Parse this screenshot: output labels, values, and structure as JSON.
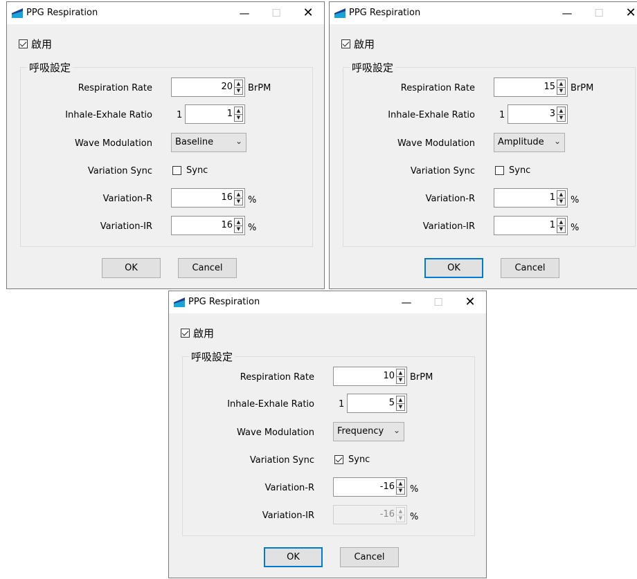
{
  "dialogs": [
    {
      "title": "PPG Respiration",
      "enable_label": "啟用",
      "enabled": true,
      "group_title": "呼吸設定",
      "labels": {
        "respiration_rate": "Respiration Rate",
        "inhale_exhale_ratio": "Inhale-Exhale Ratio",
        "wave_modulation": "Wave Modulation",
        "variation_sync": "Variation Sync",
        "variation_r": "Variation-R",
        "variation_ir": "Variation-IR"
      },
      "respiration_rate": "20",
      "rate_unit": "BrPM",
      "ratio_prefix": "1 :",
      "ratio_value": "1",
      "wave_modulation": "Baseline",
      "sync_label": "Sync",
      "sync_checked": false,
      "variation_r": "16",
      "variation_ir": "16",
      "variation_ir_disabled": false,
      "pct_unit": "%",
      "ok_label": "OK",
      "cancel_label": "Cancel",
      "ok_focused": false
    },
    {
      "title": "PPG Respiration",
      "enable_label": "啟用",
      "enabled": true,
      "group_title": "呼吸設定",
      "labels": {
        "respiration_rate": "Respiration Rate",
        "inhale_exhale_ratio": "Inhale-Exhale Ratio",
        "wave_modulation": "Wave Modulation",
        "variation_sync": "Variation Sync",
        "variation_r": "Variation-R",
        "variation_ir": "Variation-IR"
      },
      "respiration_rate": "15",
      "rate_unit": "BrPM",
      "ratio_prefix": "1 :",
      "ratio_value": "3",
      "wave_modulation": "Amplitude",
      "sync_label": "Sync",
      "sync_checked": false,
      "variation_r": "1",
      "variation_ir": "1",
      "variation_ir_disabled": false,
      "pct_unit": "%",
      "ok_label": "OK",
      "cancel_label": "Cancel",
      "ok_focused": true
    },
    {
      "title": "PPG Respiration",
      "enable_label": "啟用",
      "enabled": true,
      "group_title": "呼吸設定",
      "labels": {
        "respiration_rate": "Respiration Rate",
        "inhale_exhale_ratio": "Inhale-Exhale Ratio",
        "wave_modulation": "Wave Modulation",
        "variation_sync": "Variation Sync",
        "variation_r": "Variation-R",
        "variation_ir": "Variation-IR"
      },
      "respiration_rate": "10",
      "rate_unit": "BrPM",
      "ratio_prefix": "1 :",
      "ratio_value": "5",
      "wave_modulation": "Frequency",
      "sync_label": "Sync",
      "sync_checked": true,
      "variation_r": "-16",
      "variation_ir": "-16",
      "variation_ir_disabled": true,
      "pct_unit": "%",
      "ok_label": "OK",
      "cancel_label": "Cancel",
      "ok_focused": true
    }
  ],
  "icons": {
    "app": "ppg-app-icon",
    "minimize": "minimize-icon",
    "maximize": "maximize-icon",
    "close": "close-icon",
    "spin_up": "spin-up-icon",
    "spin_down": "spin-down-icon",
    "dropdown": "chevron-down-icon"
  },
  "colors": {
    "app_icon_top": "#1f3f8f",
    "app_icon_bottom": "#1aa3d6",
    "focus_border": "#0078d7"
  }
}
